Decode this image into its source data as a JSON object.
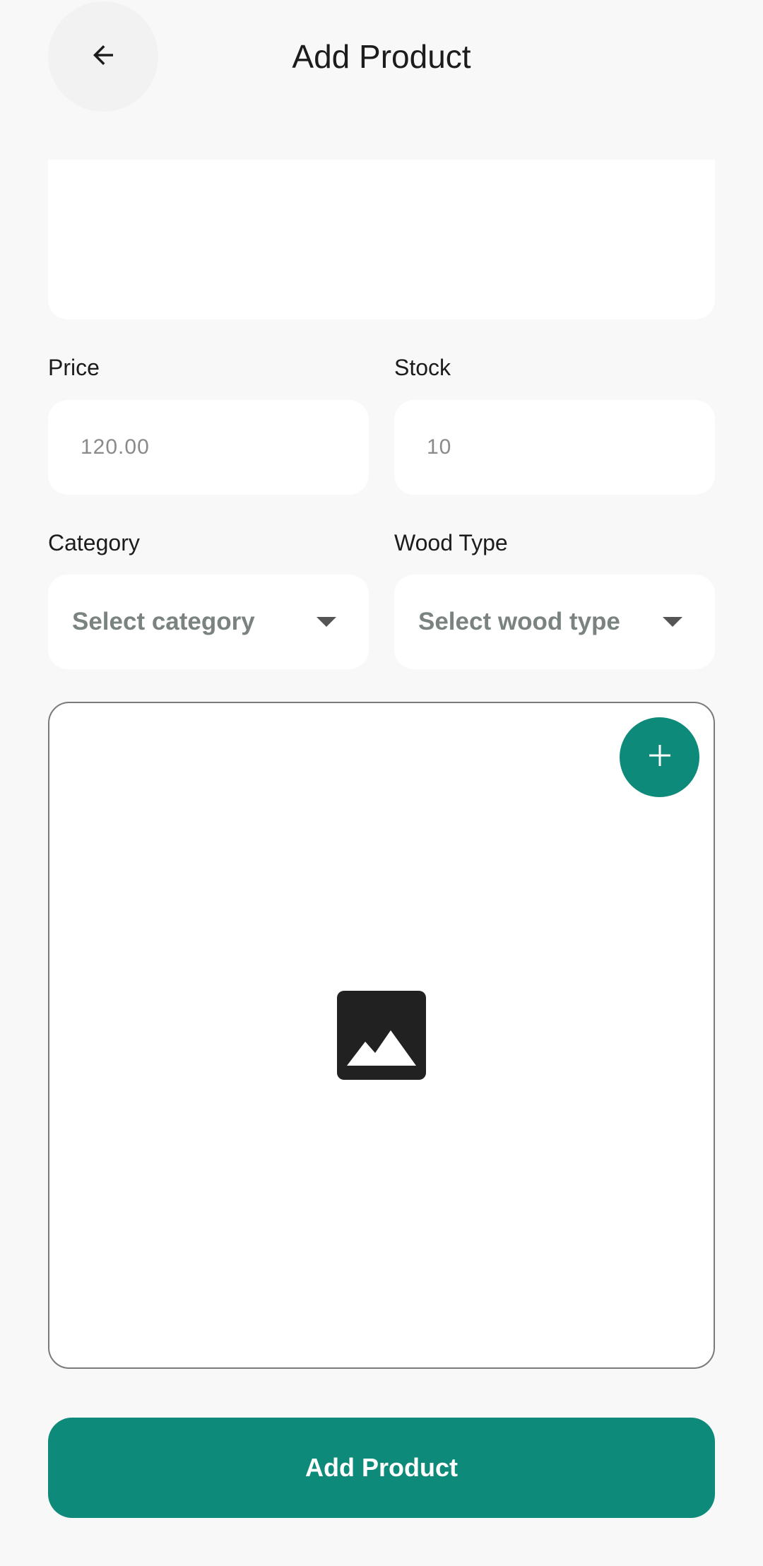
{
  "header": {
    "title": "Add Product",
    "back_icon": "arrow-left-icon"
  },
  "price": {
    "label": "Price",
    "placeholder": "120.00",
    "value": ""
  },
  "stock": {
    "label": "Stock",
    "placeholder": "10",
    "value": ""
  },
  "category": {
    "label": "Category",
    "selected": "Select category",
    "icon": "dropdown-caret-icon"
  },
  "wood_type": {
    "label": "Wood Type",
    "selected": "Select wood type",
    "icon": "dropdown-caret-icon"
  },
  "image_picker": {
    "placeholder_icon": "image-icon",
    "add_icon": "plus-icon"
  },
  "submit": {
    "label": "Add Product"
  },
  "colors": {
    "accent": "#0e8a7a",
    "background": "#f8f8f8",
    "surface": "#ffffff"
  }
}
